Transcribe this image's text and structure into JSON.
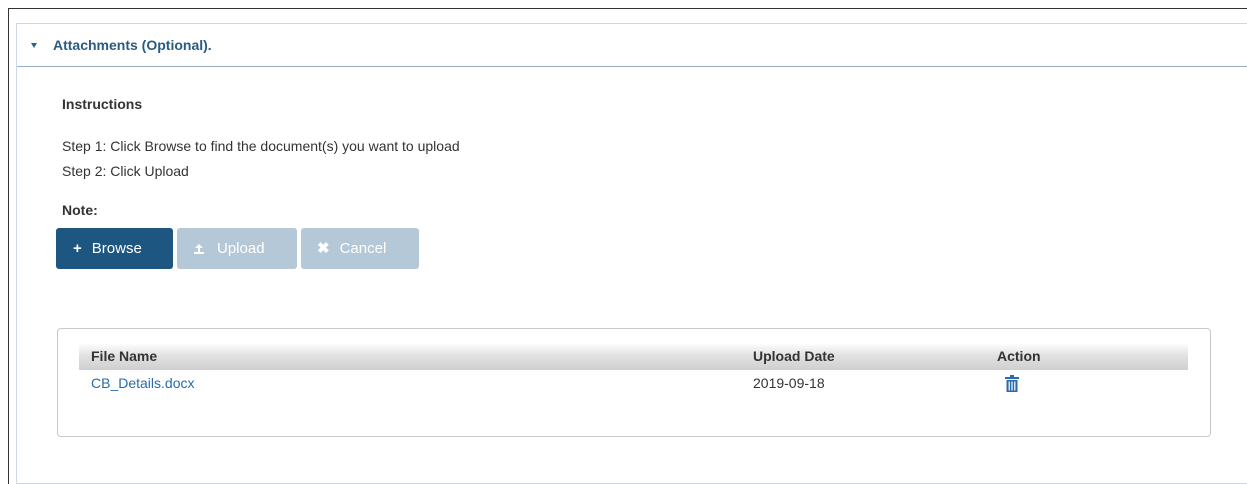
{
  "panel": {
    "title": "Attachments (Optional).",
    "toggle_icon": "caret-down-icon"
  },
  "instructions": {
    "title": "Instructions",
    "step1": "Step 1: Click Browse to find the document(s) you want to upload",
    "step2": "Step 2: Click Upload",
    "note_label": "Note:"
  },
  "buttons": {
    "browse": {
      "label": "Browse",
      "icon": "plus-icon",
      "enabled": true
    },
    "upload": {
      "label": "Upload",
      "icon": "upload-icon",
      "enabled": false
    },
    "cancel": {
      "label": "Cancel",
      "icon": "x-icon",
      "enabled": false
    }
  },
  "files_table": {
    "columns": [
      "File Name",
      "Upload Date",
      "Action"
    ],
    "rows": [
      {
        "file_name": "CB_Details.docx",
        "upload_date": "2019-09-18",
        "action_icon": "trash-icon"
      }
    ]
  },
  "colors": {
    "primary": "#1d5680",
    "disabled": "#b5c8d7",
    "link": "#2a6bab",
    "header_text": "#2a5b80"
  }
}
